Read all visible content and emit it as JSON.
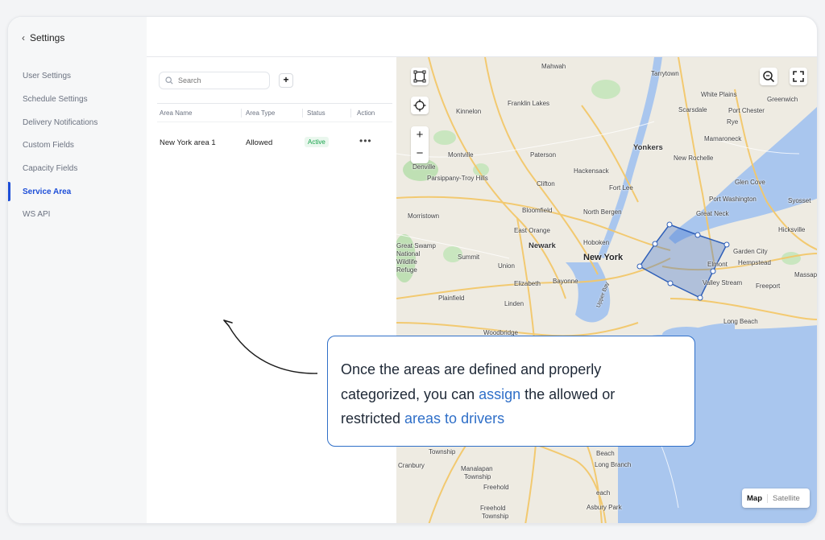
{
  "sidebar": {
    "back_label": "Settings",
    "items": [
      {
        "label": "User Settings",
        "active": false
      },
      {
        "label": "Schedule Settings",
        "active": false
      },
      {
        "label": "Delivery Notifications",
        "active": false
      },
      {
        "label": "Custom Fields",
        "active": false
      },
      {
        "label": "Capacity Fields",
        "active": false
      },
      {
        "label": "Service Area",
        "active": true
      },
      {
        "label": "WS API",
        "active": false
      }
    ]
  },
  "search": {
    "placeholder": "Search"
  },
  "add_button": {
    "label": "+"
  },
  "table": {
    "headers": [
      "Area Name",
      "Area Type",
      "Status",
      "Action"
    ],
    "rows": [
      {
        "area_name": "New York area 1",
        "area_type": "Allowed",
        "status": "Active",
        "action": "•••"
      }
    ]
  },
  "map": {
    "labels": {
      "mahwah": "Mahwah",
      "tarrytown": "Tarrytown",
      "white_plains": "White Plains",
      "greenwich": "Greenwich",
      "franklin_lakes": "Franklin Lakes",
      "kinnelon": "Kinnelon",
      "scarsdale": "Scarsdale",
      "port_chester": "Port Chester",
      "rye": "Rye",
      "mamaroneck": "Mamaroneck",
      "yonkers": "Yonkers",
      "new_rochelle": "New Rochelle",
      "montville": "Montville",
      "paterson": "Paterson",
      "denville": "Denville",
      "hackensack": "Hackensack",
      "parsippany": "Parsippany-Troy Hills",
      "clifton": "Clifton",
      "fort_lee": "Fort Lee",
      "glen_cove": "Glen Cove",
      "port_washington": "Port Washington",
      "syosset": "Syosset",
      "morristown": "Morristown",
      "bloomfield": "Bloomfield",
      "north_bergen": "North Bergen",
      "great_neck": "Great Neck",
      "hicksville": "Hicksville",
      "east_orange": "East Orange",
      "newark": "Newark",
      "hoboken": "Hoboken",
      "new_york": "New York",
      "garden_city": "Garden City",
      "summit": "Summit",
      "union": "Union",
      "great_swamp": "Great Swamp",
      "national": "National",
      "wildlife": "Wildlife",
      "refuge": "Refuge",
      "elmont": "Elmont",
      "hempstead": "Hempstead",
      "elizabeth": "Elizabeth",
      "bayonne": "Bayonne",
      "valley_stream": "Valley Stream",
      "freeport": "Freeport",
      "massape": "Massape",
      "plainfield": "Plainfield",
      "linden": "Linden",
      "long_beach": "Long Beach",
      "woodbridge": "Woodbridge",
      "upper_bay": "Upper Bay",
      "township": "Township",
      "cranbury": "Cranbury",
      "manalapan": "Manalapan",
      "manalapan_township": "Township",
      "long_branch": "Long Branch",
      "freehold": "Freehold",
      "asbury_park": "Asbury Park",
      "freehold_township": "Freehold",
      "freehold_township2": "Township",
      "beach": "Beach",
      "each": "each"
    },
    "map_type": {
      "map": "Map",
      "satellite": "Satellite"
    }
  },
  "callout": {
    "line1": "Once the areas are defined and properly",
    "line2_a": "categorized, you can ",
    "line2_link": "assign",
    "line2_b": " the allowed or",
    "line3_a": "restricted ",
    "line3_link": "areas to drivers"
  },
  "colors": {
    "accent": "#1d4ed8",
    "callout_border": "#2f6fc8",
    "status_active": "#16a34a",
    "water": "#a9c6ee",
    "polygon": "#3b6fcc"
  }
}
